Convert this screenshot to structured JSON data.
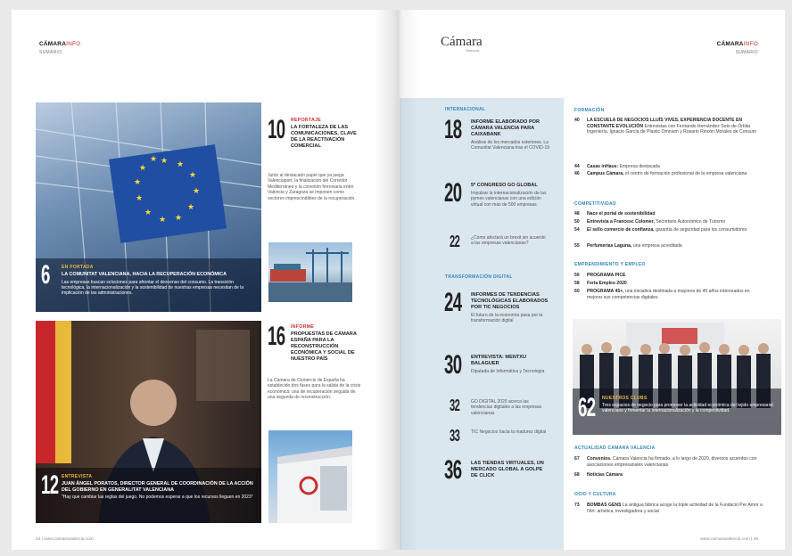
{
  "left": {
    "brand": {
      "main": "CÁMARA",
      "accent": "INFO"
    },
    "section_label": "SUMARIO",
    "story1": {
      "num": "6",
      "kicker": "EN PORTADA",
      "title": "LA COMUNITAT VALENCIANA, HACIA LA RECUPERACIÓN ECONÓMICA",
      "body": "Las empresas buscan soluciones para afrontar el descenso del consumo. La transición tecnológica, la internacionalización y la sostenibilidad de nuestras empresas necesitan de la implicación de las administraciones."
    },
    "story2": {
      "num": "10",
      "kicker": "REPORTAJE",
      "title": "LA FORTALEZA DE LAS COMUNICACIONES, CLAVE DE LA REACTIVACIÓN COMERCIAL",
      "body": "Junto al destacado papel que ya juega Valenciaport, la finalización del Corredor Mediterráneo y la conexión ferroviaria entre Valencia y Zaragoza se imponen como vectores imprescindibles de la recuperación."
    },
    "story3": {
      "num": "12",
      "kicker": "ENTREVISTA",
      "title": "JUAN ÁNGEL PORATOS, DIRECTOR GENERAL DE COORDINACIÓN DE LA ACCIÓN DEL GOBIERNO EN GENERALITAT VALENCIANA",
      "body": "\"Hay que cambiar las reglas del juego. No podemos esperar a que los recursos lleguen en 2023\""
    },
    "story4": {
      "num": "16",
      "kicker": "INFORME",
      "title": "PROPUESTAS DE CÁMARA ESPAÑA PARA LA RECONSTRUCCIÓN ECONÓMICA Y SOCIAL DE NUESTRO PAÍS",
      "body": "La Cámara de Comercio de España ha establecido dos fases para la salida de la crisis económica: una de recuperación seguida de una segunda de reconstrucción."
    },
    "footer": "44  |  www.camaravalencia.com"
  },
  "right": {
    "logo": {
      "main": "Cámara",
      "sub": "Valencia"
    },
    "brand": {
      "main": "CÁMARA",
      "accent": "INFO"
    },
    "section_label": "SUMARIO",
    "blue_col": {
      "sec1": "INTERNACIONAL",
      "items1": [
        {
          "num": "18",
          "title": "INFORME ELABORADO POR CÁMARA VALENCIA PARA CAIXABANK",
          "body": "Análisis de los mercados exteriores. La Comunitat Valenciana tras el COVID-19"
        },
        {
          "num": "20",
          "title": "5º CONGRESO GO GLOBAL",
          "body": "Impulsar la internacionalización de las pymes valencianas con una edición virtual con más de 500 empresas"
        },
        {
          "num": "22",
          "title": "",
          "body": "¿Cómo afectará un brexit sin acuerdo a las empresas valencianas?"
        }
      ],
      "sec2": "TRANSFORMACIÓN DIGITAL",
      "items2": [
        {
          "num": "24",
          "title": "INFORMES DE TENDENCIAS TECNOLÓGICAS ELABORADOS POR TIC NEGOCIOS",
          "body": "El futuro de la economía pasa por la transformación digital"
        },
        {
          "num": "30",
          "title": "ENTREVISTA: MENTXU BALAGUER",
          "body": "Diputada de Informática y Tecnología"
        },
        {
          "num": "32",
          "title": "",
          "body": "GO DIGITAL 2020 acerca las tendencias digitales a las empresas valencianas"
        },
        {
          "num": "33",
          "title": "",
          "body": "TIC Negocios hacia la madurez digital"
        },
        {
          "num": "36",
          "title": "LAS TIENDAS VIRTUALES, UN MERCADO GLOBAL A GOLPE DE CLICK",
          "body": ""
        }
      ]
    },
    "toc": {
      "formacion": {
        "label": "FORMACIÓN",
        "items": [
          {
            "n": "40",
            "b": "LA ESCUELA DE NEGOCIOS LLUÍS VIVES, EXPERIENCIA DOCENTE EN CONSTANTE EVOLUCIÓN",
            "t": "Entrevistas con Fernando Hernández Soto de Órbita Ingeniería, Ignacio García de Plastic Omnium y Rosario Rincón Morales de Consum"
          },
          {
            "n": "44",
            "b": "Casas inHaus:",
            "t": "Empresa destacada"
          },
          {
            "n": "46",
            "b": "Campus Cámara,",
            "t": "el centro de formación profesional de la empresa valenciana"
          }
        ]
      },
      "competitividad": {
        "label": "COMPETITIVIDAD",
        "items": [
          {
            "n": "48",
            "b": "Nace el portal de sostenibilidad",
            "t": ""
          },
          {
            "n": "50",
            "b": "Entrevista a Francesc Colomer,",
            "t": "Secretario Autonómico de Turismo"
          },
          {
            "n": "54",
            "b": "El sello comercio de confianza,",
            "t": "garantía de seguridad para los consumidores"
          },
          {
            "n": "55",
            "b": "Perfumerías Laguna,",
            "t": "una empresa acreditada"
          }
        ]
      },
      "emprendimiento": {
        "label": "EMPRENDIMIENTO Y EMPLEO",
        "items": [
          {
            "n": "56",
            "b": "PROGRAMA PICE",
            "t": ""
          },
          {
            "n": "58",
            "b": "Feria Empleo 2020",
            "t": ""
          },
          {
            "n": "60",
            "b": "PROGRAMA 45+,",
            "t": "una iniciativa destinada a mayores de 45 años interesados en mejorar sus competencias digitales"
          }
        ]
      },
      "clubs": {
        "num": "62",
        "kicker": "NUESTROS CLUBS",
        "body": "Tres espacios de negocio para promover la actividad económica del tejido empresarial valenciano y fomentar la internacionalización y la competitividad."
      },
      "actualidad": {
        "label": "ACTUALIDAD CÁMARA VALENCIA",
        "items": [
          {
            "n": "67",
            "b": "Convenios.",
            "t": "Cámara Valencia ha firmado, a lo largo de 2020, diversos acuerdos con asociaciones empresariales valencianas"
          },
          {
            "n": "68",
            "b": "Noticias Cámara",
            "t": ""
          }
        ]
      },
      "ocio": {
        "label": "OCIO Y CULTURA",
        "items": [
          {
            "n": "73",
            "b": "BOMBAS GENS",
            "t": "La antigua fábrica acoge la triple actividad de la Fundació Per Amor a l'Art: artística, investigadora y social"
          }
        ]
      }
    },
    "footer": "www.camaravalencia.com  |  45"
  },
  "colors": {
    "accent_red": "#c9312e",
    "section_blue": "#2f86b8",
    "blue_column": "#dbe7ef"
  }
}
